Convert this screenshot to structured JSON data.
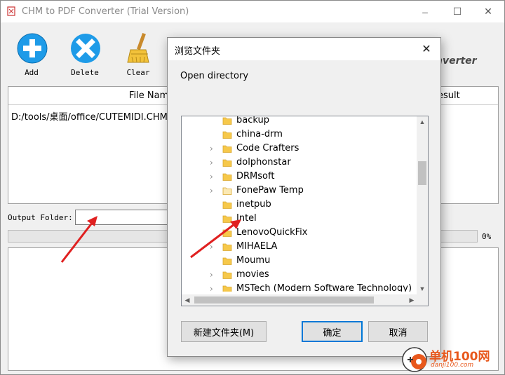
{
  "window": {
    "title": "CHM to PDF Converter (Trial Version)",
    "minimize": "–",
    "maximize": "☐",
    "close": "✕"
  },
  "toolbar": {
    "add_label": "Add",
    "delete_label": "Delete",
    "clear_label": "Clear",
    "brand_text": "nverter"
  },
  "file_table": {
    "col_file_name": "File Name",
    "col_result": "esult",
    "rows": [
      {
        "file_name": "D:/tools/桌面/office/CUTEMIDI.CHM",
        "result": ""
      }
    ]
  },
  "output": {
    "label": "Output Folder:",
    "value": ""
  },
  "progress": {
    "percent_text": "0%",
    "value": 0
  },
  "dialog": {
    "title": "浏览文件夹",
    "close": "✕",
    "description": "Open directory",
    "folders": [
      {
        "name": "backup",
        "expandable": false
      },
      {
        "name": "china-drm",
        "expandable": false
      },
      {
        "name": "Code Crafters",
        "expandable": true
      },
      {
        "name": "dolphonstar",
        "expandable": true
      },
      {
        "name": "DRMsoft",
        "expandable": true
      },
      {
        "name": "FonePaw Temp",
        "expandable": true
      },
      {
        "name": "inetpub",
        "expandable": false
      },
      {
        "name": "Intel",
        "expandable": false
      },
      {
        "name": "LenovoQuickFix",
        "expandable": false
      },
      {
        "name": "MIHAELA",
        "expandable": true
      },
      {
        "name": "Moumu",
        "expandable": false
      },
      {
        "name": "movies",
        "expandable": true
      },
      {
        "name": "MSTech (Modern Software Technology)",
        "expandable": true
      }
    ],
    "new_folder_label": "新建文件夹(M)",
    "ok_label": "确定",
    "cancel_label": "取消"
  },
  "watermark": {
    "line1": "单机100网",
    "line2": "danji100.com"
  },
  "colors": {
    "add_blue": "#1e9be8",
    "delete_blue": "#1e9be8",
    "folder_yellow": "#f6c84a",
    "arrow_red": "#e02020",
    "accent": "#0078d7"
  }
}
